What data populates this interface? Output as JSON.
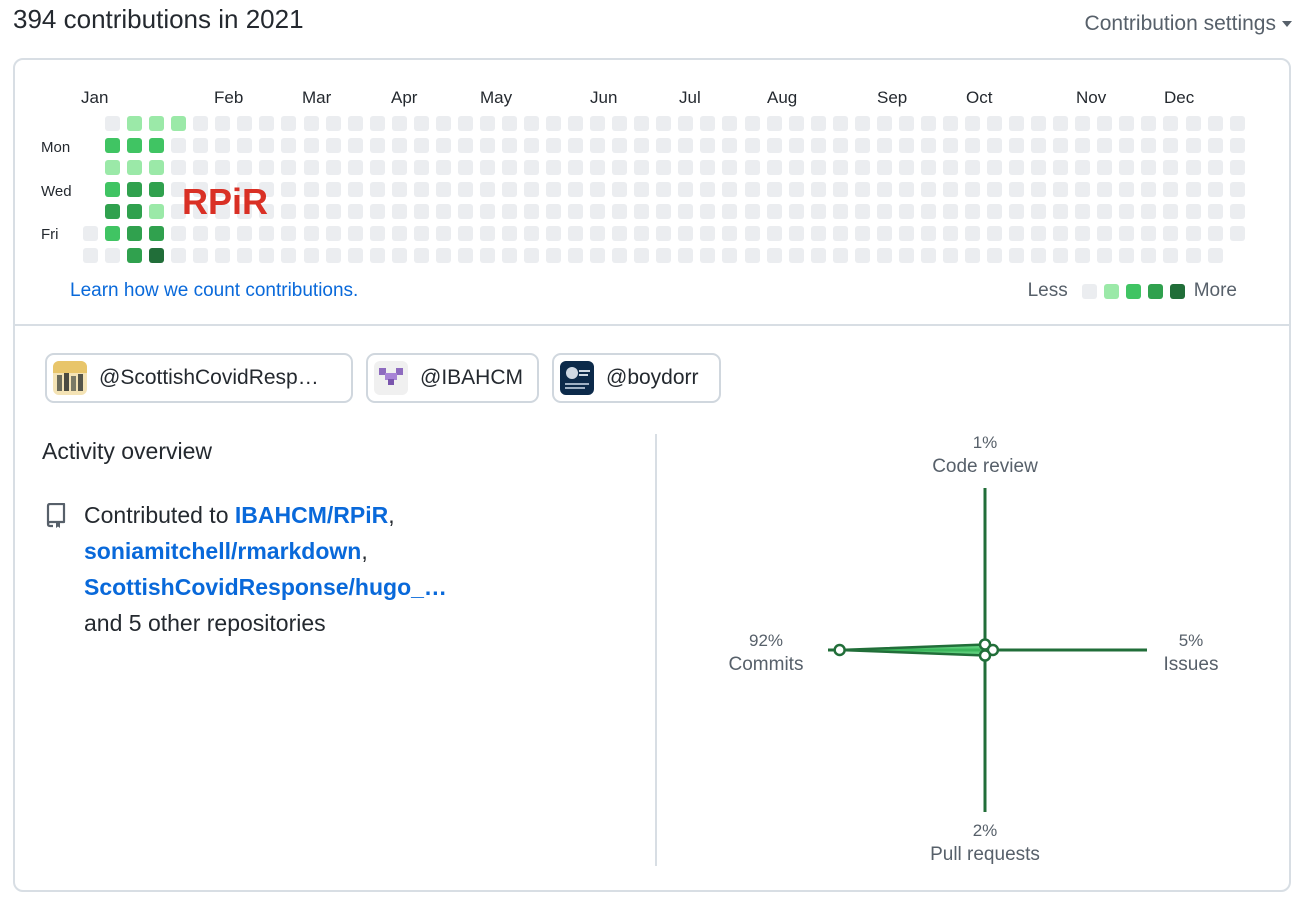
{
  "header": {
    "title": "394 contributions in 2021",
    "settings_label": "Contribution settings"
  },
  "calendar": {
    "months": [
      "Jan",
      "Feb",
      "Mar",
      "Apr",
      "May",
      "Jun",
      "Jul",
      "Aug",
      "Sep",
      "Oct",
      "Nov",
      "Dec"
    ],
    "day_labels": [
      "Mon",
      "Wed",
      "Fri"
    ],
    "overlay_text": "RPiR",
    "learn_link": "Learn how we count contributions.",
    "legend_less": "Less",
    "legend_more": "More",
    "colors": [
      "#ebedf0",
      "#9be9a8",
      "#40c463",
      "#30a14e",
      "#216e39"
    ],
    "weeks": 53,
    "first_week_start_row": 5,
    "last_week_end_row": 5,
    "active_cells": [
      {
        "week": 0,
        "day": 5,
        "level": 0
      },
      {
        "week": 1,
        "day": 1,
        "level": 2
      },
      {
        "week": 1,
        "day": 2,
        "level": 1
      },
      {
        "week": 1,
        "day": 3,
        "level": 2
      },
      {
        "week": 1,
        "day": 4,
        "level": 3
      },
      {
        "week": 1,
        "day": 5,
        "level": 2
      },
      {
        "week": 2,
        "day": 0,
        "level": 1
      },
      {
        "week": 2,
        "day": 1,
        "level": 2
      },
      {
        "week": 2,
        "day": 2,
        "level": 1
      },
      {
        "week": 2,
        "day": 3,
        "level": 3
      },
      {
        "week": 2,
        "day": 4,
        "level": 3
      },
      {
        "week": 2,
        "day": 5,
        "level": 3
      },
      {
        "week": 2,
        "day": 6,
        "level": 3
      },
      {
        "week": 3,
        "day": 0,
        "level": 1
      },
      {
        "week": 3,
        "day": 1,
        "level": 2
      },
      {
        "week": 3,
        "day": 2,
        "level": 1
      },
      {
        "week": 3,
        "day": 3,
        "level": 3
      },
      {
        "week": 3,
        "day": 4,
        "level": 1
      },
      {
        "week": 3,
        "day": 5,
        "level": 3
      },
      {
        "week": 3,
        "day": 6,
        "level": 4
      },
      {
        "week": 4,
        "day": 0,
        "level": 1
      }
    ]
  },
  "organizations": [
    {
      "handle": "@ScottishCovidResp…",
      "avatar": "scottishcovid-avatar"
    },
    {
      "handle": "@IBAHCM",
      "avatar": "ibahcm-avatar"
    },
    {
      "handle": "@boydorr",
      "avatar": "boydorr-avatar"
    }
  ],
  "activity": {
    "title": "Activity overview",
    "prefix": "Contributed to",
    "repos": [
      "IBAHCM/RPiR",
      "soniamitchell/rmarkdown",
      "ScottishCovidResponse/hugo_…"
    ],
    "suffix": "and 5 other repositories"
  },
  "radar": {
    "code_review": {
      "label": "Code review",
      "percent": "1%",
      "value": 1
    },
    "issues": {
      "label": "Issues",
      "percent": "5%",
      "value": 5
    },
    "pull_requests": {
      "label": "Pull requests",
      "percent": "2%",
      "value": 2
    },
    "commits": {
      "label": "Commits",
      "percent": "92%",
      "value": 92
    },
    "line_color": "#216e39",
    "fill_color": "#40c463"
  }
}
